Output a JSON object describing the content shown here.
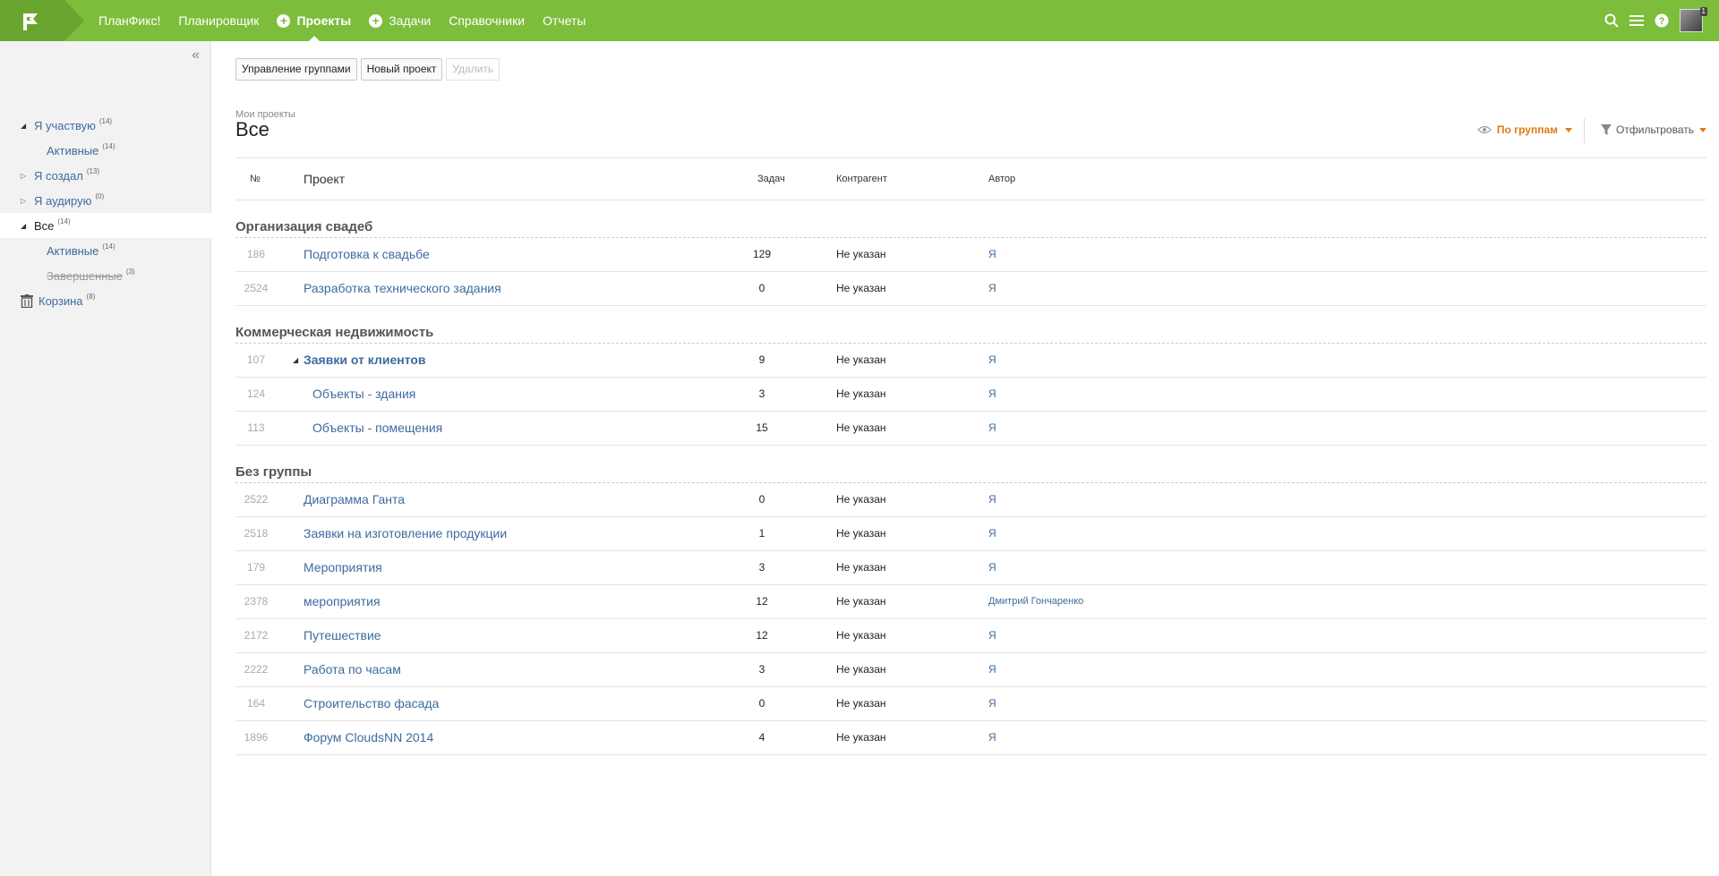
{
  "header": {
    "nav": [
      {
        "label": "ПланФикс!",
        "active": false,
        "plus": false
      },
      {
        "label": "Планировщик",
        "active": false,
        "plus": false
      },
      {
        "label": "Проекты",
        "active": true,
        "plus": true
      },
      {
        "label": "Задачи",
        "active": false,
        "plus": true
      },
      {
        "label": "Справочники",
        "active": false,
        "plus": false
      },
      {
        "label": "Отчеты",
        "active": false,
        "plus": false
      }
    ],
    "avatar_badge": "1",
    "icons": [
      "search-icon",
      "menu-icon",
      "help-icon"
    ]
  },
  "sidebar": {
    "collapse_glyph": "«",
    "items": [
      {
        "label": "Я участвую",
        "count": "(14)",
        "toggle": "open"
      },
      {
        "label": "Активные",
        "count": "(14)",
        "toggle": "child"
      },
      {
        "label": "Я создал",
        "count": "(13)",
        "toggle": "closed"
      },
      {
        "label": "Я аудирую",
        "count": "(0)",
        "toggle": "closed"
      },
      {
        "label": "Все",
        "count": "(14)",
        "toggle": "open",
        "selected": true
      },
      {
        "label": "Активные",
        "count": "(14)",
        "toggle": "child"
      },
      {
        "label": "Завершенные",
        "count": "(3)",
        "toggle": "child",
        "struck": true
      },
      {
        "label": "Корзина",
        "count": "(8)",
        "toggle": "trash"
      }
    ]
  },
  "toolbar": {
    "manage_groups": "Управление группами",
    "new_project": "Новый проект",
    "delete": "Удалить"
  },
  "page": {
    "breadcrumb": "Мои проекты",
    "title": "Все",
    "view_label": "По группам",
    "filter_label": "Отфильтровать"
  },
  "table": {
    "columns": {
      "num": "№",
      "project": "Проект",
      "tasks": "Задач",
      "client": "Контрагент",
      "author": "Автор"
    },
    "groups": [
      {
        "title": "Организация свадеб",
        "rows": [
          {
            "num": "186",
            "name": "Подготовка к свадьбе",
            "tasks": "129",
            "client": "Не указан",
            "author": "Я"
          },
          {
            "num": "2524",
            "name": "Разработка технического задания",
            "tasks": "0",
            "client": "Не указан",
            "author": "Я"
          }
        ]
      },
      {
        "title": "Коммерческая недвижимость",
        "rows": [
          {
            "num": "107",
            "name": "Заявки от клиентов",
            "tasks": "9",
            "client": "Не указан",
            "author": "Я",
            "parent": true
          },
          {
            "num": "124",
            "name": "Объекты - здания",
            "tasks": "3",
            "client": "Не указан",
            "author": "Я",
            "child": true
          },
          {
            "num": "113",
            "name": "Объекты - помещения",
            "tasks": "15",
            "client": "Не указан",
            "author": "Я",
            "child": true
          }
        ]
      },
      {
        "title": "Без группы",
        "rows": [
          {
            "num": "2522",
            "name": "Диаграмма Ганта",
            "tasks": "0",
            "client": "Не указан",
            "author": "Я"
          },
          {
            "num": "2518",
            "name": "Заявки на изготовление продукции",
            "tasks": "1",
            "client": "Не указан",
            "author": "Я"
          },
          {
            "num": "179",
            "name": "Мероприятия",
            "tasks": "3",
            "client": "Не указан",
            "author": "Я"
          },
          {
            "num": "2378",
            "name": "мероприятия",
            "tasks": "12",
            "client": "Не указан",
            "author": "Дмитрий Гончаренко"
          },
          {
            "num": "2172",
            "name": "Путешествие",
            "tasks": "12",
            "client": "Не указан",
            "author": "Я"
          },
          {
            "num": "2222",
            "name": "Работа по часам",
            "tasks": "3",
            "client": "Не указан",
            "author": "Я"
          },
          {
            "num": "164",
            "name": "Строительство фасада",
            "tasks": "0",
            "client": "Не указан",
            "author": "Я"
          },
          {
            "num": "1896",
            "name": "Форум CloudsNN 2014",
            "tasks": "4",
            "client": "Не указан",
            "author": "Я"
          }
        ]
      }
    ]
  }
}
